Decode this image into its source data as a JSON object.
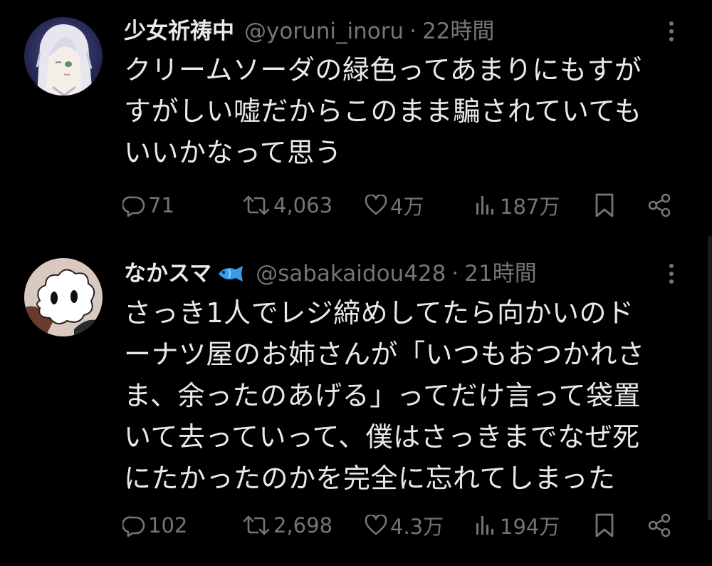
{
  "tweets": [
    {
      "author_name": "少女祈祷中",
      "author_handle": "@yoruni_inoru",
      "separator": "·",
      "time": "22時間",
      "text_lines": [
        "クリームソーダの緑色ってあまりにもすが",
        "すがしい嘘だからこのまま騙されていても",
        "いいかなって思う"
      ],
      "stats": {
        "replies": "71",
        "retweets": "4,063",
        "likes": "4万",
        "views": "187万"
      },
      "avatar_icon": "anime-girl-avatar"
    },
    {
      "author_name": "なかスマ",
      "name_emoji": "fish-icon",
      "author_handle": "@sabakaidou428",
      "separator": "·",
      "time": "21時間",
      "text_lines": [
        "さっき1人でレジ締めしてたら向かいのド",
        "ーナツ屋のお姉さんが「いつもおつかれさ",
        "ま、余ったのあげる」ってだけ言って袋置",
        "いて去っていって、僕はさっきまでなぜ死",
        "にたかったのかを完全に忘れてしまった"
      ],
      "stats": {
        "replies": "102",
        "retweets": "2,698",
        "likes": "4.3万",
        "views": "194万"
      },
      "avatar_icon": "white-cloud-creature-avatar"
    }
  ],
  "colors": {
    "background": "#000000",
    "primary_text": "#e7e9ea",
    "secondary_text": "#71767b",
    "fish_blue": "#3b9be8"
  }
}
